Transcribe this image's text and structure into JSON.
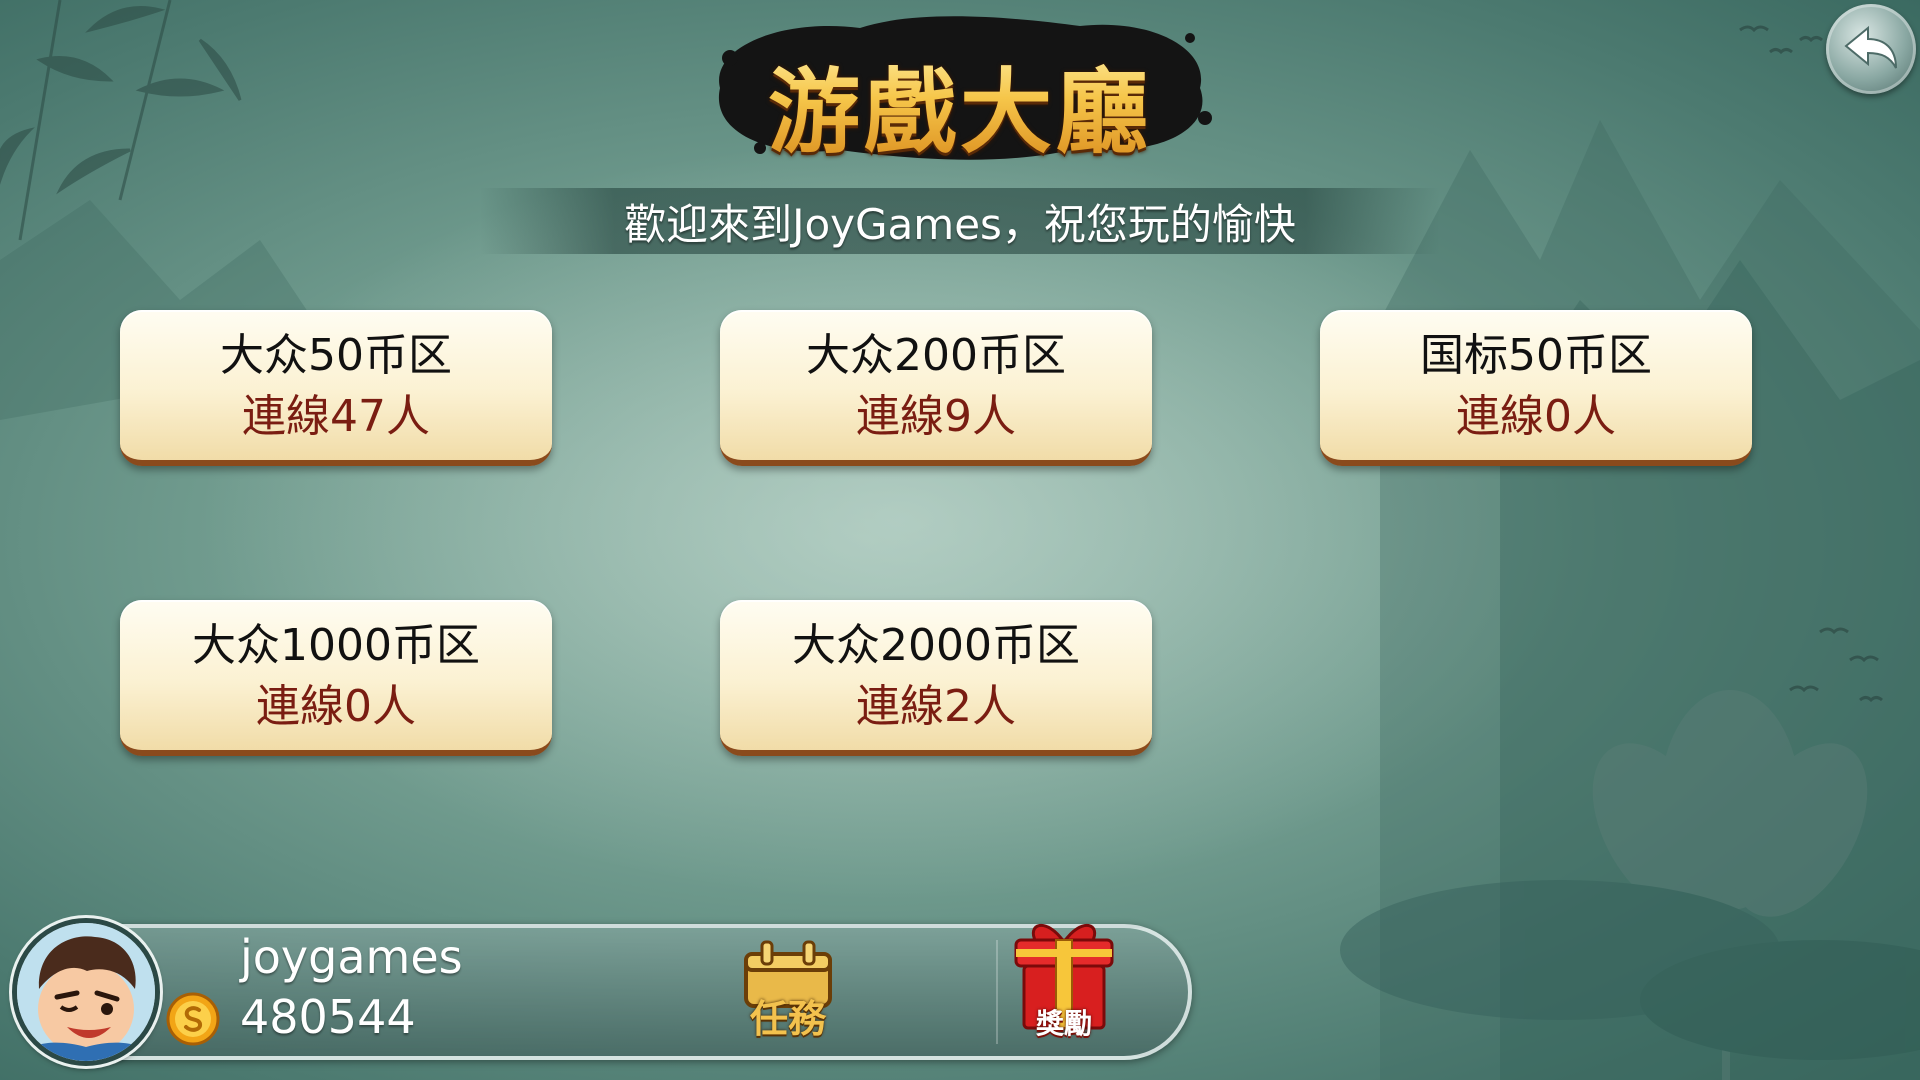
{
  "header": {
    "title": "游戲大廳",
    "welcome_text": "歡迎來到JoyGames，祝您玩的愉快"
  },
  "rooms": [
    {
      "name": "大众50币区",
      "online": "連線47人"
    },
    {
      "name": "大众200币区",
      "online": "連線9人"
    },
    {
      "name": "国标50币区",
      "online": "連線0人"
    },
    {
      "name": "大众1000币区",
      "online": "連線0人"
    },
    {
      "name": "大众2000币区",
      "online": "連線2人"
    }
  ],
  "player": {
    "username": "joygames",
    "coins": "480544"
  },
  "bar_buttons": {
    "task_label": "任務",
    "reward_label": "獎勵"
  },
  "icons": {
    "back": "back-arrow-icon",
    "coin": "coin-icon",
    "task": "calendar-icon",
    "reward": "gift-icon"
  },
  "colors": {
    "background": "#6f9a8d",
    "card": "#fbf1d2",
    "card_border": "#8a4a1c",
    "online_text": "#7a1d12",
    "title_gold": "#f6c64a"
  }
}
